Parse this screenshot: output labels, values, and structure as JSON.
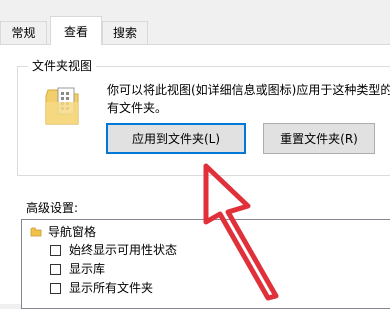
{
  "tabs": [
    {
      "label": "常规",
      "active": false
    },
    {
      "label": "查看",
      "active": true
    },
    {
      "label": "搜索",
      "active": false
    }
  ],
  "folder_views": {
    "group_title": "文件夹视图",
    "description_line1": "你可以将此视图(如详细信息或图标)应用于这种类型的",
    "description_line2": "有文件夹。",
    "apply_button": "应用到文件夹(L)",
    "reset_button": "重置文件夹(R)"
  },
  "advanced": {
    "label": "高级设置:",
    "tree_root": "导航窗格",
    "items": [
      {
        "label": "始终显示可用性状态",
        "checked": false
      },
      {
        "label": "显示库",
        "checked": false
      },
      {
        "label": "显示所有文件夹",
        "checked": false
      }
    ]
  },
  "colors": {
    "accent_border": "#0078d7",
    "annotation_arrow": "#e0303a"
  }
}
